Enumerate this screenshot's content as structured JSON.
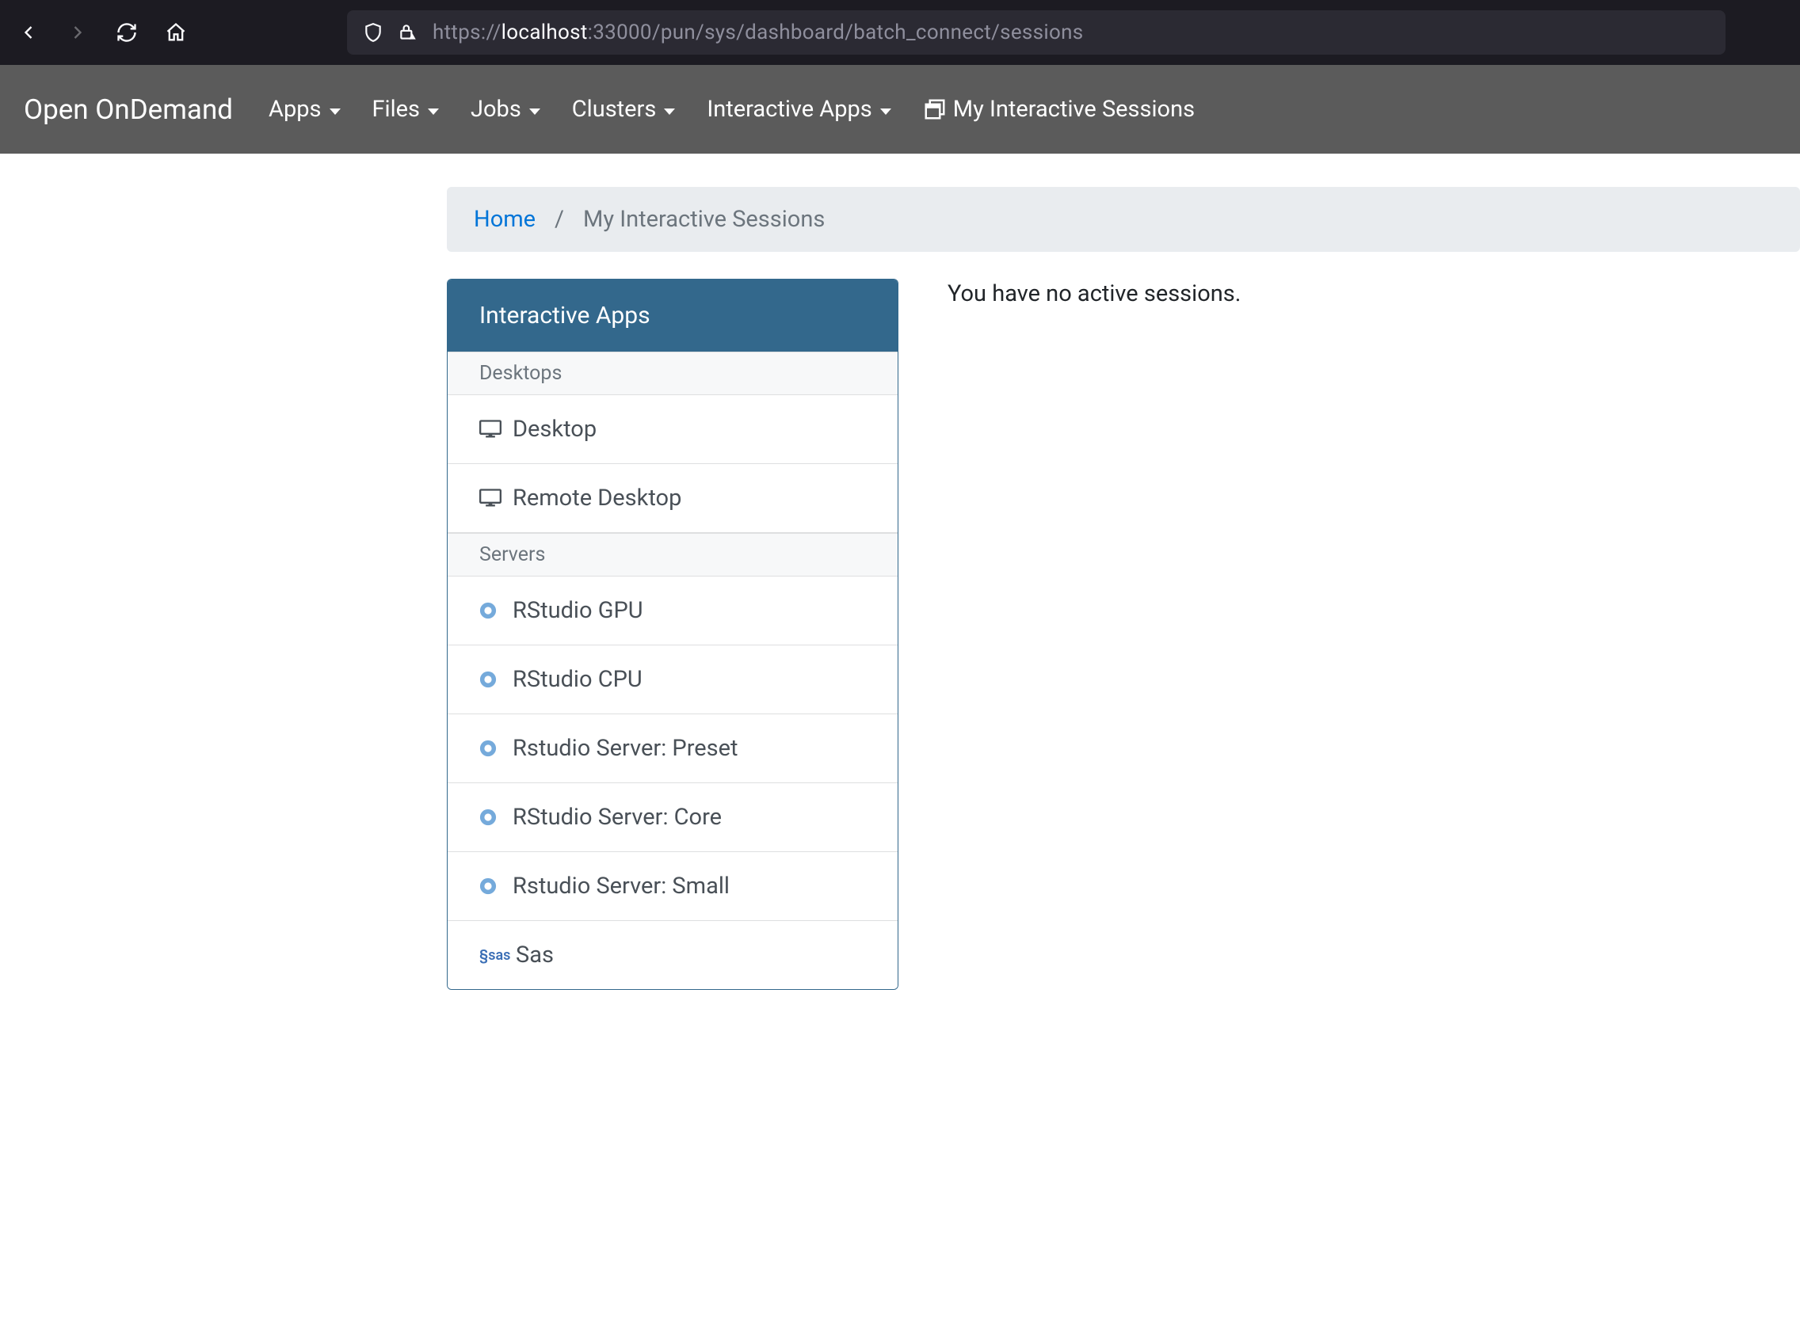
{
  "browser": {
    "url_prefix": "https://",
    "url_host": "localhost",
    "url_suffix": ":33000/pun/sys/dashboard/batch_connect/sessions"
  },
  "navbar": {
    "brand": "Open OnDemand",
    "links": {
      "apps": "Apps",
      "files": "Files",
      "jobs": "Jobs",
      "clusters": "Clusters",
      "interactive_apps": "Interactive Apps",
      "my_sessions": "My Interactive Sessions"
    }
  },
  "breadcrumb": {
    "home": "Home",
    "sep": "/",
    "current": "My Interactive Sessions"
  },
  "sidebar": {
    "header": "Interactive Apps",
    "group_desktops": "Desktops",
    "group_servers": "Servers",
    "items": {
      "desktop": "Desktop",
      "remote_desktop": "Remote Desktop",
      "rstudio_gpu": "RStudio GPU",
      "rstudio_cpu": "RStudio CPU",
      "rstudio_preset": "Rstudio Server: Preset",
      "rstudio_core": "RStudio Server: Core",
      "rstudio_small": "Rstudio Server: Small",
      "sas": "Sas"
    }
  },
  "main": {
    "no_sessions": "You have no active sessions."
  }
}
